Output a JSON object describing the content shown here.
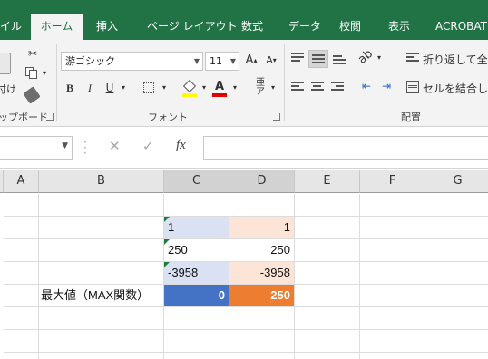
{
  "ribbon_tabs": [
    "イル",
    "ホーム",
    "挿入",
    "ページ レイアウト",
    "数式",
    "データ",
    "校閲",
    "表示",
    "ACROBAT"
  ],
  "active_tab": "ホーム",
  "clipboard": {
    "paste_label": "付け",
    "group_label": "ップボード"
  },
  "font": {
    "name": "游ゴシック",
    "size": "11",
    "group_label": "フォント",
    "bold": "B",
    "italic": "I",
    "underline": "U"
  },
  "alignment": {
    "wrap_label": "折り返して全体",
    "merge_label": "セルを結合して",
    "group_label": "配置"
  },
  "formula_bar": {
    "fx": "fx",
    "name_box": "",
    "content": ""
  },
  "columns": [
    "A",
    "B",
    "C",
    "D",
    "E",
    "F",
    "G"
  ],
  "rows": [
    {
      "b": "",
      "c": "1",
      "d": "1"
    },
    {
      "b": "",
      "c": "250",
      "d": "250"
    },
    {
      "b": "",
      "c": "-3958",
      "d": "-3958"
    },
    {
      "b": "最大値（MAX関数）",
      "c": "0",
      "d": "250"
    }
  ],
  "colors": {
    "ribbon": "#217346",
    "c_fill": "#d9e1f2",
    "d_fill": "#fce4d6",
    "c_result": "#4472c4",
    "d_result": "#ed7d31",
    "text_error_tri": "#1e7d3a"
  }
}
